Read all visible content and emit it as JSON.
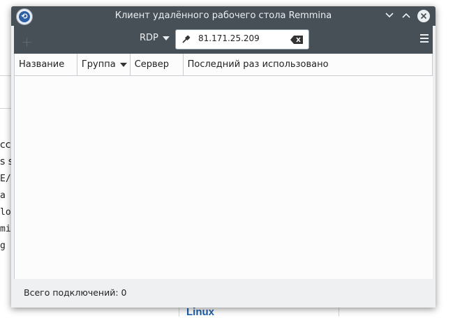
{
  "background_page": {
    "fragments": [
      "cco",
      "s s",
      "E/.",
      "a f",
      "loc",
      "mi",
      "g"
    ],
    "link": "Linux"
  },
  "window": {
    "title": "Клиент удалённого рабочего стола Remmina",
    "app_icon": "remmina-icon",
    "controls": [
      "minimize-icon",
      "maximize-icon",
      "close-icon"
    ]
  },
  "toolbar": {
    "new_connection_icon": "plus-icon",
    "protocol": "RDP",
    "address_value": "81.171.25.209",
    "address_icon": "plug-icon",
    "clear_icon": "backspace-icon",
    "menu_icon": "hamburger-icon"
  },
  "table": {
    "columns": [
      "Название",
      "Группа",
      "Сервер",
      "Последний раз использовано"
    ],
    "sort_column": "Группа",
    "rows": []
  },
  "status": {
    "text": "Всего подключений: 0"
  },
  "colors": {
    "header_bar": "#475057",
    "window_bg": "#eff0f1",
    "list_bg": "#fcfcfc",
    "link": "#1f5fae"
  }
}
